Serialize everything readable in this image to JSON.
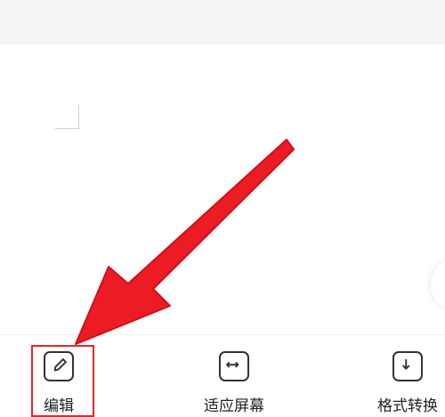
{
  "toolbar": {
    "items": [
      {
        "label": "编辑",
        "icon": "edit-icon"
      },
      {
        "label": "适应屏幕",
        "icon": "fit-screen-icon"
      },
      {
        "label": "格式转换",
        "icon": "format-convert-icon"
      }
    ]
  },
  "annotation": {
    "highlight_color": "#e02a2a",
    "arrow_color": "#ec1c24"
  }
}
